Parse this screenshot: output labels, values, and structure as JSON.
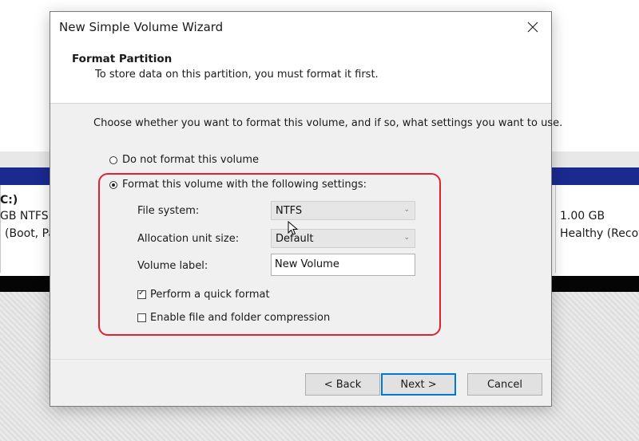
{
  "background": {
    "left_volume": {
      "label": "C:)",
      "size": "GB NTFS",
      "status": "(Boot, Pa"
    },
    "right_volume": {
      "size": "1.00 GB",
      "status": "Healthy (Recov"
    }
  },
  "dialog": {
    "title": "New Simple Volume Wizard",
    "header_title": "Format Partition",
    "header_subtitle": "To store data on this partition, you must format it first.",
    "instruction": "Choose whether you want to format this volume, and if so, what settings you want to use.",
    "option_no_format": "Do not format this volume",
    "option_format": "Format this volume with the following settings:",
    "selected_option": "format",
    "file_system_label": "File system:",
    "file_system_value": "NTFS",
    "alloc_label": "Allocation unit size:",
    "alloc_value": "Default",
    "volume_label_label": "Volume label:",
    "volume_label_value": "New Volume",
    "quick_format_label": "Perform a quick format",
    "quick_format_checked": true,
    "compression_label": "Enable file and folder compression",
    "compression_checked": false,
    "back_label": "< Back",
    "next_label": "Next >",
    "cancel_label": "Cancel"
  },
  "colors": {
    "highlight_outline": "#e0212e",
    "volume_bar": "#1a2a8f"
  },
  "icons": {
    "close": "close-icon",
    "dropdown": "chevron-down-icon",
    "pointer": "mouse-cursor-icon"
  }
}
